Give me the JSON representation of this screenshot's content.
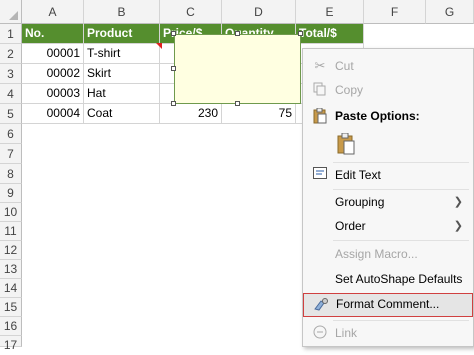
{
  "columns": [
    "A",
    "B",
    "C",
    "D",
    "E",
    "F",
    "G"
  ],
  "rows": [
    "1",
    "2",
    "3",
    "4",
    "5",
    "6",
    "7",
    "8",
    "9",
    "10",
    "11",
    "12",
    "13",
    "14",
    "15",
    "16",
    "17"
  ],
  "header_row": {
    "a": "No.",
    "b": "Product",
    "c": "Price/$",
    "d": "Quantity",
    "e": "Total/$"
  },
  "data_rows": [
    {
      "a": "00001",
      "b": "T-shirt",
      "c": "",
      "d": "",
      "e": ""
    },
    {
      "a": "00002",
      "b": "Skirt",
      "c": "",
      "d": "",
      "e": ""
    },
    {
      "a": "00003",
      "b": "Hat",
      "c": "",
      "d": "",
      "e": ""
    },
    {
      "a": "00004",
      "b": "Coat",
      "c": "230",
      "d": "75",
      "e": ""
    }
  ],
  "colors": {
    "header_green": "#558e2e",
    "comment_fill": "#ffffe1",
    "highlight_border": "#d04040"
  },
  "menu": {
    "cut": "Cut",
    "copy": "Copy",
    "paste_options": "Paste Options:",
    "edit_text": "Edit Text",
    "grouping": "Grouping",
    "order": "Order",
    "assign_macro": "Assign Macro...",
    "set_autoshape": "Set AutoShape Defaults",
    "format_comment": "Format Comment...",
    "link": "Link"
  }
}
